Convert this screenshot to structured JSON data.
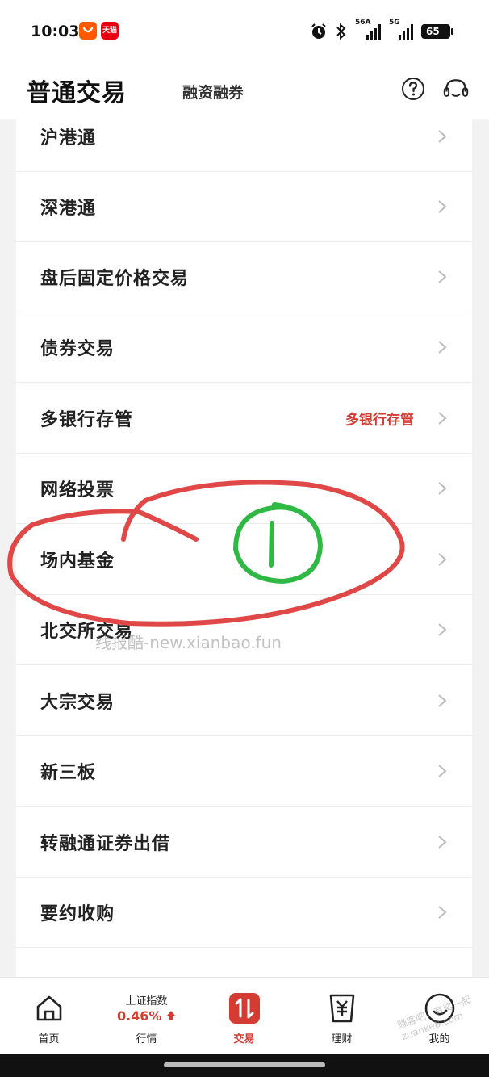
{
  "status_bar": {
    "time": "10:03",
    "app_badge_1": "",
    "app_badge_2": "天猫",
    "signal_1_label": "56A",
    "signal_2_label": "5G",
    "battery": "65"
  },
  "header": {
    "title": "普通交易",
    "tab": "融资融券",
    "help_icon": "question-circle-icon",
    "service_icon": "headset-icon"
  },
  "list": {
    "items": [
      {
        "label": "沪港通",
        "extra": ""
      },
      {
        "label": "深港通",
        "extra": ""
      },
      {
        "label": "盘后固定价格交易",
        "extra": ""
      },
      {
        "label": "债券交易",
        "extra": ""
      },
      {
        "label": "多银行存管",
        "extra": "多银行存管"
      },
      {
        "label": "网络投票",
        "extra": ""
      },
      {
        "label": "场内基金",
        "extra": ""
      },
      {
        "label": "北交所交易",
        "extra": ""
      },
      {
        "label": "大宗交易",
        "extra": ""
      },
      {
        "label": "新三板",
        "extra": ""
      },
      {
        "label": "转融通证券出借",
        "extra": ""
      },
      {
        "label": "要约收购",
        "extra": ""
      }
    ]
  },
  "annotations": {
    "watermark": "线报酷-new.xianbao.fun",
    "watermark_corner": "赚客吧，有奖一起 zuanke8.com"
  },
  "bottom_nav": {
    "home": "首页",
    "index_name": "上证指数",
    "index_value": "0.46%",
    "market": "行情",
    "trade": "交易",
    "finance": "理财",
    "mine": "我的"
  },
  "colors": {
    "accent": "#d43b33",
    "circle_red": "#e04848",
    "circle_green": "#2fb844"
  }
}
